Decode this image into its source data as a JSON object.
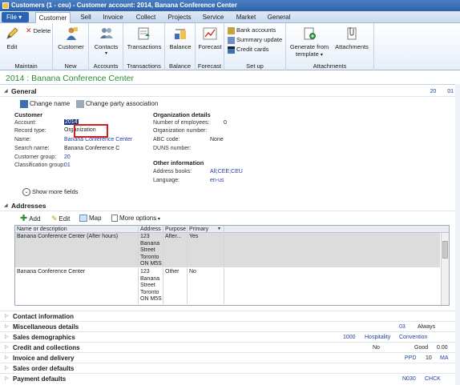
{
  "window": {
    "title": "Customers (1 - ceu) - Customer account: 2014, Banana Conference Center"
  },
  "tabs": {
    "file": "File",
    "items": [
      "Customer",
      "Sell",
      "Invoice",
      "Collect",
      "Projects",
      "Service",
      "Market",
      "General"
    ],
    "active": "Customer"
  },
  "ribbon": {
    "maintain": {
      "edit": "Edit",
      "delete": "Delete",
      "group": "Maintain"
    },
    "new": {
      "customer": "Customer",
      "group": "New"
    },
    "accounts": {
      "contacts": "Contacts",
      "group": "Accounts"
    },
    "transactions": {
      "transactions": "Transactions",
      "group": "Transactions"
    },
    "balance": {
      "balance": "Balance",
      "group": "Balance"
    },
    "forecast": {
      "forecast": "Forecast",
      "group": "Forecast"
    },
    "setup": {
      "bank_accounts": "Bank accounts",
      "summary_update": "Summary update",
      "credit_cards": "Credit cards",
      "group": "Set up"
    },
    "attachments": {
      "generate": "Generate from",
      "generate2": "template",
      "attachments": "Attachments",
      "group": "Attachments"
    }
  },
  "form": {
    "title": "2014 : Banana Conference Center"
  },
  "general": {
    "header": "General",
    "summary": [
      "20",
      "01"
    ],
    "change_name": "Change name",
    "change_party": "Change party association",
    "customer_section": "Customer",
    "fields": [
      {
        "label": "Account:",
        "value": "2014"
      },
      {
        "label": "Record type:",
        "value": "Organization"
      },
      {
        "label": "Name:",
        "value": "Banana Conference Center"
      },
      {
        "label": "Search name:",
        "value": "Banana Conference C"
      },
      {
        "label": "Customer group:",
        "value": "20"
      },
      {
        "label": "Classification group:",
        "value": "01"
      }
    ],
    "org_section": "Organization details",
    "org_fields": [
      {
        "label": "Number of employees:",
        "value": "0"
      },
      {
        "label": "Organization number:",
        "value": ""
      },
      {
        "label": "ABC code:",
        "value": "None"
      },
      {
        "label": "DUNS number:",
        "value": ""
      }
    ],
    "other_section": "Other information",
    "other_fields": [
      {
        "label": "Address books:",
        "value": "All;CEE;CEU"
      },
      {
        "label": "Language:",
        "value": "en-us"
      }
    ],
    "show_more": "Show more fields"
  },
  "addresses": {
    "header": "Addresses",
    "add": "Add",
    "edit": "Edit",
    "map": "Map",
    "more_options": "More options",
    "columns": [
      "Name or description",
      "Address",
      "Purpose",
      "Primary"
    ],
    "rows": [
      {
        "name": "Banana Conference Center (After hours)",
        "address": [
          "123",
          "Banana",
          "Street",
          "Toronto",
          "ON M5S"
        ],
        "purpose": "After...",
        "primary": "Yes"
      },
      {
        "name": "Banana Conference Center",
        "address": [
          "123",
          "Banana",
          "Street",
          "Toronto",
          "ON M5S"
        ],
        "purpose": "Other",
        "primary": "No"
      }
    ]
  },
  "collapsed": [
    {
      "label": "Contact information",
      "sums": []
    },
    {
      "label": "Miscellaneous details",
      "sums": [
        "03",
        "Always"
      ]
    },
    {
      "label": "Sales demographics",
      "sums": [
        "1000",
        "Hospitality",
        "Convention"
      ]
    },
    {
      "label": "Credit and collections",
      "sums": [
        "No",
        "Good",
        "0.00"
      ]
    },
    {
      "label": "Invoice and delivery",
      "sums": [
        "PPD",
        "10",
        "MA"
      ]
    },
    {
      "label": "Sales order defaults",
      "sums": []
    },
    {
      "label": "Payment defaults",
      "sums": [
        "N030",
        "CHCK"
      ]
    }
  ],
  "colors": {
    "accent": "#2b63b5",
    "form_title": "#2b8a3e",
    "highlight": "#d21f1f",
    "link": "#2040a0"
  }
}
